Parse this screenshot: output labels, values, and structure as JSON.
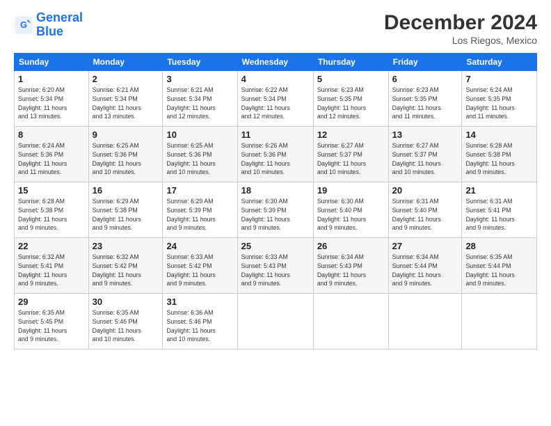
{
  "header": {
    "logo_line1": "General",
    "logo_line2": "Blue",
    "month": "December 2024",
    "location": "Los Riegos, Mexico"
  },
  "weekdays": [
    "Sunday",
    "Monday",
    "Tuesday",
    "Wednesday",
    "Thursday",
    "Friday",
    "Saturday"
  ],
  "weeks": [
    [
      {
        "day": "1",
        "info": "Sunrise: 6:20 AM\nSunset: 5:34 PM\nDaylight: 11 hours\nand 13 minutes."
      },
      {
        "day": "2",
        "info": "Sunrise: 6:21 AM\nSunset: 5:34 PM\nDaylight: 11 hours\nand 13 minutes."
      },
      {
        "day": "3",
        "info": "Sunrise: 6:21 AM\nSunset: 5:34 PM\nDaylight: 11 hours\nand 12 minutes."
      },
      {
        "day": "4",
        "info": "Sunrise: 6:22 AM\nSunset: 5:34 PM\nDaylight: 11 hours\nand 12 minutes."
      },
      {
        "day": "5",
        "info": "Sunrise: 6:23 AM\nSunset: 5:35 PM\nDaylight: 11 hours\nand 12 minutes."
      },
      {
        "day": "6",
        "info": "Sunrise: 6:23 AM\nSunset: 5:35 PM\nDaylight: 11 hours\nand 11 minutes."
      },
      {
        "day": "7",
        "info": "Sunrise: 6:24 AM\nSunset: 5:35 PM\nDaylight: 11 hours\nand 11 minutes."
      }
    ],
    [
      {
        "day": "8",
        "info": "Sunrise: 6:24 AM\nSunset: 5:36 PM\nDaylight: 11 hours\nand 11 minutes."
      },
      {
        "day": "9",
        "info": "Sunrise: 6:25 AM\nSunset: 5:36 PM\nDaylight: 11 hours\nand 10 minutes."
      },
      {
        "day": "10",
        "info": "Sunrise: 6:25 AM\nSunset: 5:36 PM\nDaylight: 11 hours\nand 10 minutes."
      },
      {
        "day": "11",
        "info": "Sunrise: 6:26 AM\nSunset: 5:36 PM\nDaylight: 11 hours\nand 10 minutes."
      },
      {
        "day": "12",
        "info": "Sunrise: 6:27 AM\nSunset: 5:37 PM\nDaylight: 11 hours\nand 10 minutes."
      },
      {
        "day": "13",
        "info": "Sunrise: 6:27 AM\nSunset: 5:37 PM\nDaylight: 11 hours\nand 10 minutes."
      },
      {
        "day": "14",
        "info": "Sunrise: 6:28 AM\nSunset: 5:38 PM\nDaylight: 11 hours\nand 9 minutes."
      }
    ],
    [
      {
        "day": "15",
        "info": "Sunrise: 6:28 AM\nSunset: 5:38 PM\nDaylight: 11 hours\nand 9 minutes."
      },
      {
        "day": "16",
        "info": "Sunrise: 6:29 AM\nSunset: 5:38 PM\nDaylight: 11 hours\nand 9 minutes."
      },
      {
        "day": "17",
        "info": "Sunrise: 6:29 AM\nSunset: 5:39 PM\nDaylight: 11 hours\nand 9 minutes."
      },
      {
        "day": "18",
        "info": "Sunrise: 6:30 AM\nSunset: 5:39 PM\nDaylight: 11 hours\nand 9 minutes."
      },
      {
        "day": "19",
        "info": "Sunrise: 6:30 AM\nSunset: 5:40 PM\nDaylight: 11 hours\nand 9 minutes."
      },
      {
        "day": "20",
        "info": "Sunrise: 6:31 AM\nSunset: 5:40 PM\nDaylight: 11 hours\nand 9 minutes."
      },
      {
        "day": "21",
        "info": "Sunrise: 6:31 AM\nSunset: 5:41 PM\nDaylight: 11 hours\nand 9 minutes."
      }
    ],
    [
      {
        "day": "22",
        "info": "Sunrise: 6:32 AM\nSunset: 5:41 PM\nDaylight: 11 hours\nand 9 minutes."
      },
      {
        "day": "23",
        "info": "Sunrise: 6:32 AM\nSunset: 5:42 PM\nDaylight: 11 hours\nand 9 minutes."
      },
      {
        "day": "24",
        "info": "Sunrise: 6:33 AM\nSunset: 5:42 PM\nDaylight: 11 hours\nand 9 minutes."
      },
      {
        "day": "25",
        "info": "Sunrise: 6:33 AM\nSunset: 5:43 PM\nDaylight: 11 hours\nand 9 minutes."
      },
      {
        "day": "26",
        "info": "Sunrise: 6:34 AM\nSunset: 5:43 PM\nDaylight: 11 hours\nand 9 minutes."
      },
      {
        "day": "27",
        "info": "Sunrise: 6:34 AM\nSunset: 5:44 PM\nDaylight: 11 hours\nand 9 minutes."
      },
      {
        "day": "28",
        "info": "Sunrise: 6:35 AM\nSunset: 5:44 PM\nDaylight: 11 hours\nand 9 minutes."
      }
    ],
    [
      {
        "day": "29",
        "info": "Sunrise: 6:35 AM\nSunset: 5:45 PM\nDaylight: 11 hours\nand 9 minutes."
      },
      {
        "day": "30",
        "info": "Sunrise: 6:35 AM\nSunset: 5:46 PM\nDaylight: 11 hours\nand 10 minutes."
      },
      {
        "day": "31",
        "info": "Sunrise: 6:36 AM\nSunset: 5:46 PM\nDaylight: 11 hours\nand 10 minutes."
      },
      {
        "day": "",
        "info": ""
      },
      {
        "day": "",
        "info": ""
      },
      {
        "day": "",
        "info": ""
      },
      {
        "day": "",
        "info": ""
      }
    ]
  ]
}
